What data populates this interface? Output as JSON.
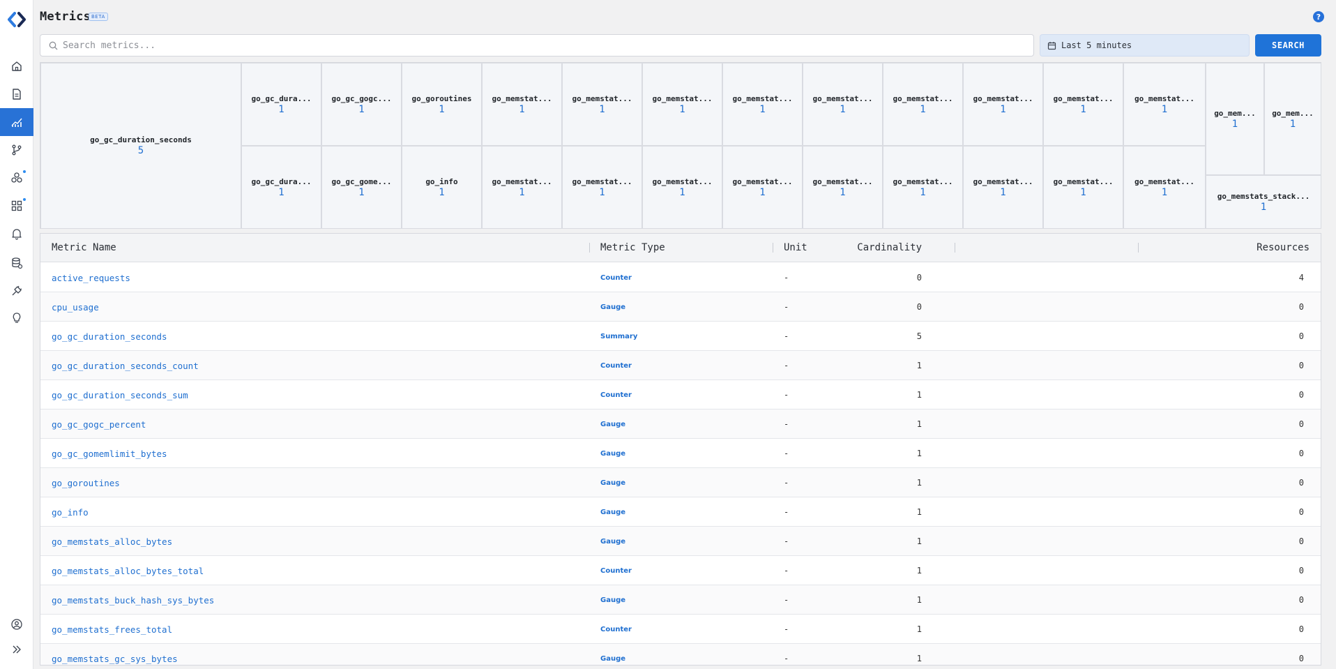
{
  "page": {
    "title": "Metrics",
    "badge": "BETA",
    "help": "?"
  },
  "search": {
    "placeholder": "Search metrics...",
    "value": ""
  },
  "time_range": {
    "label": "Last 5 minutes"
  },
  "search_button": {
    "label": "SEARCH"
  },
  "sidebar": {
    "items": [
      "home",
      "logs",
      "metrics",
      "traces",
      "services",
      "dashboards",
      "alerts",
      "databases",
      "integrations",
      "insights",
      "account",
      "expand"
    ],
    "active": "metrics"
  },
  "treemap": {
    "large": {
      "name": "go_gc_duration_seconds",
      "count": "5"
    },
    "top_row": [
      {
        "name": "go_gc_dura...",
        "count": "1"
      },
      {
        "name": "go_gc_gogc...",
        "count": "1"
      },
      {
        "name": "go_goroutines",
        "count": "1"
      },
      {
        "name": "go_memstat...",
        "count": "1"
      },
      {
        "name": "go_memstat...",
        "count": "1"
      },
      {
        "name": "go_memstat...",
        "count": "1"
      },
      {
        "name": "go_memstat...",
        "count": "1"
      },
      {
        "name": "go_memstat...",
        "count": "1"
      },
      {
        "name": "go_memstat...",
        "count": "1"
      },
      {
        "name": "go_memstat...",
        "count": "1"
      },
      {
        "name": "go_memstat...",
        "count": "1"
      },
      {
        "name": "go_memstat...",
        "count": "1"
      }
    ],
    "bottom_row": [
      {
        "name": "go_gc_dura...",
        "count": "1"
      },
      {
        "name": "go_gc_gome...",
        "count": "1"
      },
      {
        "name": "go_info",
        "count": "1"
      },
      {
        "name": "go_memstat...",
        "count": "1"
      },
      {
        "name": "go_memstat...",
        "count": "1"
      },
      {
        "name": "go_memstat...",
        "count": "1"
      },
      {
        "name": "go_memstat...",
        "count": "1"
      },
      {
        "name": "go_memstat...",
        "count": "1"
      },
      {
        "name": "go_memstat...",
        "count": "1"
      },
      {
        "name": "go_memstat...",
        "count": "1"
      },
      {
        "name": "go_memstat...",
        "count": "1"
      },
      {
        "name": "go_memstat...",
        "count": "1"
      }
    ],
    "right_small": [
      {
        "name": "go_mem...",
        "count": "1"
      },
      {
        "name": "go_mem...",
        "count": "1"
      }
    ],
    "right_wide": {
      "name": "go_memstats_stack...",
      "count": "1"
    }
  },
  "table": {
    "headers": {
      "name": "Metric Name",
      "type": "Metric Type",
      "unit": "Unit",
      "cardinality": "Cardinality",
      "resources": "Resources"
    },
    "rows": [
      {
        "name": "active_requests",
        "type": "Counter",
        "unit": "-",
        "cardinality": "0",
        "resources": "4"
      },
      {
        "name": "cpu_usage",
        "type": "Gauge",
        "unit": "-",
        "cardinality": "0",
        "resources": "0"
      },
      {
        "name": "go_gc_duration_seconds",
        "type": "Summary",
        "unit": "-",
        "cardinality": "5",
        "resources": "0"
      },
      {
        "name": "go_gc_duration_seconds_count",
        "type": "Counter",
        "unit": "-",
        "cardinality": "1",
        "resources": "0"
      },
      {
        "name": "go_gc_duration_seconds_sum",
        "type": "Counter",
        "unit": "-",
        "cardinality": "1",
        "resources": "0"
      },
      {
        "name": "go_gc_gogc_percent",
        "type": "Gauge",
        "unit": "-",
        "cardinality": "1",
        "resources": "0"
      },
      {
        "name": "go_gc_gomemlimit_bytes",
        "type": "Gauge",
        "unit": "-",
        "cardinality": "1",
        "resources": "0"
      },
      {
        "name": "go_goroutines",
        "type": "Gauge",
        "unit": "-",
        "cardinality": "1",
        "resources": "0"
      },
      {
        "name": "go_info",
        "type": "Gauge",
        "unit": "-",
        "cardinality": "1",
        "resources": "0"
      },
      {
        "name": "go_memstats_alloc_bytes",
        "type": "Gauge",
        "unit": "-",
        "cardinality": "1",
        "resources": "0"
      },
      {
        "name": "go_memstats_alloc_bytes_total",
        "type": "Counter",
        "unit": "-",
        "cardinality": "1",
        "resources": "0"
      },
      {
        "name": "go_memstats_buck_hash_sys_bytes",
        "type": "Gauge",
        "unit": "-",
        "cardinality": "1",
        "resources": "0"
      },
      {
        "name": "go_memstats_frees_total",
        "type": "Counter",
        "unit": "-",
        "cardinality": "1",
        "resources": "0"
      },
      {
        "name": "go_memstats_gc_sys_bytes",
        "type": "Gauge",
        "unit": "-",
        "cardinality": "1",
        "resources": "0"
      }
    ]
  },
  "colors": {
    "accent": "#1f73d8",
    "link": "#1f6fd0",
    "sidebar_active": "#2872d6"
  }
}
